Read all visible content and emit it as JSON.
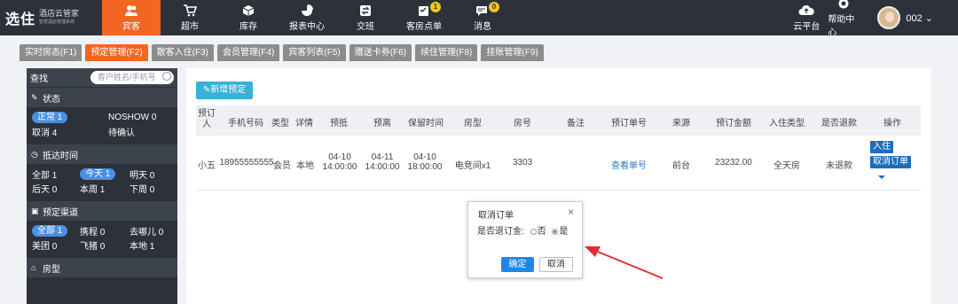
{
  "brand": {
    "name": "选住",
    "sub": "酒店云管家",
    "tiny": "智慧酒店管理系统"
  },
  "nav": [
    {
      "label": "宾客",
      "icon": "guests-icon",
      "active": true,
      "badge": ""
    },
    {
      "label": "超市",
      "icon": "cart-icon",
      "active": false,
      "badge": ""
    },
    {
      "label": "库存",
      "icon": "box-icon",
      "active": false,
      "badge": ""
    },
    {
      "label": "报表中心",
      "icon": "pie-chart-icon",
      "active": false,
      "badge": ""
    },
    {
      "label": "交班",
      "icon": "handover-icon",
      "active": false,
      "badge": ""
    },
    {
      "label": "客房点单",
      "icon": "room-order-icon",
      "active": false,
      "badge": "1"
    },
    {
      "label": "消息",
      "icon": "message-icon",
      "active": false,
      "badge": "0"
    }
  ],
  "topright": {
    "cloud": "云平台",
    "help": "帮助中心",
    "user": "002"
  },
  "tabs": [
    {
      "label": "实时房态(F1)",
      "active": false
    },
    {
      "label": "预定管理(F2)",
      "active": true
    },
    {
      "label": "散客入住(F3)",
      "active": false
    },
    {
      "label": "会员管理(F4)",
      "active": false
    },
    {
      "label": "宾客列表(F5)",
      "active": false
    },
    {
      "label": "赠送卡券(F6)",
      "active": false
    },
    {
      "label": "续住管理(F8)",
      "active": false
    },
    {
      "label": "挂账管理(F9)",
      "active": false
    }
  ],
  "sidebar": {
    "search_label": "查找",
    "search_placeholder": "客户姓名/手机号",
    "status": {
      "title": "状态",
      "r1a": "正常 1",
      "r1b": "NOSHOW 0",
      "r2a": "取消 4",
      "r2b": "待确认"
    },
    "arrival": {
      "title": "抵达时间",
      "r1a": "全部 1",
      "r1b": "今天 1",
      "r1c": "明天 0",
      "r2a": "后天 0",
      "r2b": "本周 1",
      "r2c": "下周 0"
    },
    "channel": {
      "title": "预定渠道",
      "r1a": "全部 1",
      "r1b": "携程 0",
      "r1c": "去哪儿 0",
      "r2a": "美团 0",
      "r2b": "飞猪 0",
      "r2c": "本地 1"
    },
    "room": {
      "title": "房型"
    }
  },
  "main": {
    "add_label": "新增预定",
    "headers": [
      "预订人",
      "手机号码",
      "类型",
      "详情",
      "预抵",
      "预离",
      "保留时间",
      "房型",
      "房号",
      "备注",
      "预订单号",
      "来源",
      "预订金额",
      "入住类型",
      "是否退款",
      "操作"
    ],
    "row": {
      "name": "小五",
      "phone": "18955555555",
      "type": "会员",
      "detail": "本地",
      "arrive_d": "04-10",
      "arrive_t": "14:00:00",
      "leave_d": "04-11",
      "leave_t": "14:00:00",
      "keep_d": "04-10",
      "keep_t": "18:00:00",
      "room_type": "电竞间x1",
      "room_no": "3303",
      "note": "",
      "order_link": "查看单号",
      "source": "前台",
      "amount": "23232.00",
      "checkin_type": "全天房",
      "refund": "未退款",
      "op_checkin": "入住",
      "op_cancel": "取消订单"
    }
  },
  "dialog": {
    "title": "取消订单",
    "question": "是否退订金:",
    "opt_no": "否",
    "opt_yes": "是",
    "ok": "确定",
    "cancel": "取消"
  },
  "colors": {
    "accent": "#f26522",
    "nav_bg": "#2c313a",
    "primary": "#1e88e5",
    "annotation": "#e03030"
  }
}
